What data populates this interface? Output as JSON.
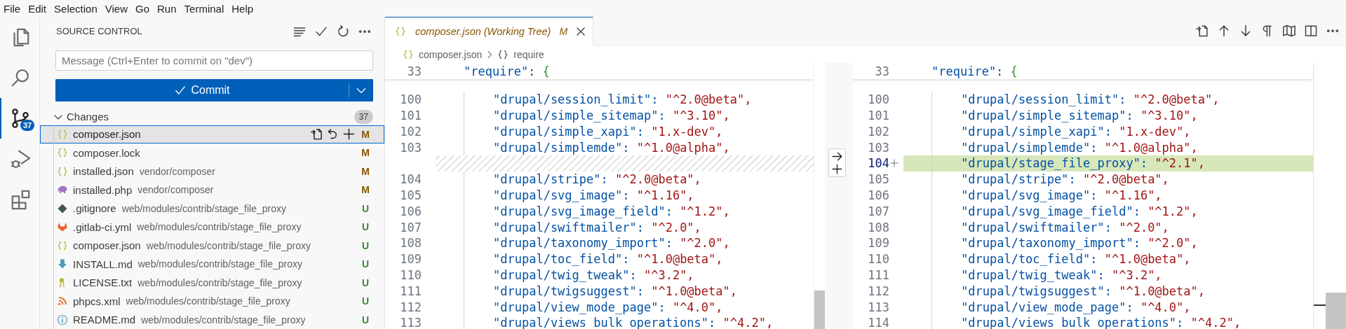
{
  "menu": [
    "File",
    "Edit",
    "Selection",
    "View",
    "Go",
    "Run",
    "Terminal",
    "Help"
  ],
  "activity_bar": [
    {
      "kind": "explorer",
      "selected": false
    },
    {
      "kind": "search",
      "selected": false
    },
    {
      "kind": "source-control",
      "selected": true,
      "badge": "37"
    },
    {
      "kind": "run-debug",
      "selected": false
    },
    {
      "kind": "extensions",
      "selected": false
    }
  ],
  "sidebar": {
    "title": "SOURCE CONTROL",
    "actions": [
      {
        "kind": "list"
      },
      {
        "kind": "check"
      },
      {
        "kind": "refresh"
      },
      {
        "kind": "more"
      }
    ],
    "message": {
      "placeholder": "Message (Ctrl+Enter to commit on \"dev\")"
    },
    "commit_button": {
      "label": "Commit"
    },
    "section": {
      "title": "Changes",
      "expanded": true,
      "count": "37",
      "files": [
        {
          "kind": "json",
          "name": "composer.json",
          "status": "M",
          "color": "#895503",
          "selected": true,
          "actions": [
            {
              "kind": "open-file"
            },
            {
              "kind": "discard"
            },
            {
              "kind": "stage"
            }
          ]
        },
        {
          "kind": "json",
          "name": "composer.lock",
          "status": "M",
          "color": "#895503",
          "selected": false
        },
        {
          "kind": "json",
          "name": "installed.json",
          "path": "vendor/composer",
          "status": "M",
          "color": "#895503",
          "selected": false
        },
        {
          "kind": "php",
          "name": "installed.php",
          "path": "vendor/composer",
          "status": "M",
          "color": "#895503",
          "selected": false
        },
        {
          "kind": "git",
          "name": ".gitignore",
          "path": "web/modules/contrib/stage_file_proxy",
          "status": "U",
          "color": "#388a34",
          "selected": false
        },
        {
          "kind": "gitlab",
          "name": ".gitlab-ci.yml",
          "path": "web/modules/contrib/stage_file_proxy",
          "status": "U",
          "color": "#388a34",
          "selected": false
        },
        {
          "kind": "json",
          "name": "composer.json",
          "path": "web/modules/contrib/stage_file_proxy",
          "status": "U",
          "color": "#388a34",
          "selected": false
        },
        {
          "kind": "download",
          "name": "INSTALL.md",
          "path": "web/modules/contrib/stage_file_proxy",
          "status": "U",
          "color": "#388a34",
          "selected": false
        },
        {
          "kind": "license",
          "name": "LICENSE.txt",
          "path": "web/modules/contrib/stage_file_proxy",
          "status": "U",
          "color": "#388a34",
          "selected": false
        },
        {
          "kind": "rss",
          "name": "phpcs.xml",
          "path": "web/modules/contrib/stage_file_proxy",
          "status": "U",
          "color": "#388a34",
          "selected": false
        },
        {
          "kind": "info",
          "name": "README.md",
          "path": "web/modules/contrib/stage_file_proxy",
          "status": "U",
          "color": "#388a34",
          "selected": false
        }
      ]
    }
  },
  "editor": {
    "tab": {
      "title": "composer.json (Working Tree)",
      "status": "M",
      "selected": true
    },
    "actions": [
      {
        "kind": "open-file"
      },
      {
        "kind": "up"
      },
      {
        "kind": "down"
      },
      {
        "kind": "pilcrow"
      },
      {
        "kind": "map"
      },
      {
        "kind": "split"
      },
      {
        "kind": "more"
      }
    ],
    "breadcrumb": [
      {
        "kind": "file",
        "label": "composer.json"
      },
      {
        "kind": "object",
        "label": "require"
      }
    ],
    "left": {
      "sticky": {
        "number": "33",
        "key": "\"require\":",
        "bracket": "{"
      },
      "lines": [
        {
          "kind": "code",
          "number": "100",
          "key": "\"drupal/session_limit\":",
          "value": "\"^2.0@beta\","
        },
        {
          "kind": "code",
          "number": "101",
          "key": "\"drupal/simple_sitemap\":",
          "value": "\"^3.10\","
        },
        {
          "kind": "code",
          "number": "102",
          "key": "\"drupal/simple_xapi\":",
          "value": "\"1.x-dev\","
        },
        {
          "kind": "code",
          "number": "103",
          "key": "\"drupal/simplemde\":",
          "value": "\"^1.0@alpha\","
        },
        {
          "kind": "gap"
        },
        {
          "kind": "code",
          "number": "104",
          "key": "\"drupal/stripe\":",
          "value": "\"^2.0@beta\","
        },
        {
          "kind": "code",
          "number": "105",
          "key": "\"drupal/svg_image\":",
          "value": "\"^1.16\","
        },
        {
          "kind": "code",
          "number": "106",
          "key": "\"drupal/svg_image_field\":",
          "value": "\"^1.2\","
        },
        {
          "kind": "code",
          "number": "107",
          "key": "\"drupal/swiftmailer\":",
          "value": "\"^2.0\","
        },
        {
          "kind": "code",
          "number": "108",
          "key": "\"drupal/taxonomy_import\":",
          "value": "\"^2.0\","
        },
        {
          "kind": "code",
          "number": "109",
          "key": "\"drupal/toc_field\":",
          "value": "\"^1.0@beta\","
        },
        {
          "kind": "code",
          "number": "110",
          "key": "\"drupal/twig_tweak\":",
          "value": "\"^3.2\","
        },
        {
          "kind": "code",
          "number": "111",
          "key": "\"drupal/twigsuggest\":",
          "value": "\"^1.0@beta\","
        },
        {
          "kind": "code",
          "number": "112",
          "key": "\"drupal/view_mode_page\":",
          "value": "\"^4.0\","
        },
        {
          "kind": "code",
          "number": "113",
          "key": "\"drupal/views bulk operations\":",
          "value": "\"^4.2\","
        }
      ]
    },
    "right": {
      "sticky": {
        "number": "33",
        "key": "\"require\":",
        "bracket": "{"
      },
      "lines": [
        {
          "kind": "code",
          "number": "100",
          "key": "\"drupal/session_limit\":",
          "value": "\"^2.0@beta\",",
          "added": false
        },
        {
          "kind": "code",
          "number": "101",
          "key": "\"drupal/simple_sitemap\":",
          "value": "\"^3.10\",",
          "added": false
        },
        {
          "kind": "code",
          "number": "102",
          "key": "\"drupal/simple_xapi\":",
          "value": "\"1.x-dev\",",
          "added": false
        },
        {
          "kind": "code",
          "number": "103",
          "key": "\"drupal/simplemde\":",
          "value": "\"^1.0@alpha\",",
          "added": false
        },
        {
          "kind": "code",
          "number": "104",
          "key": "\"drupal/stage_file_proxy\":",
          "value": "\"^2.1\",",
          "added": true
        },
        {
          "kind": "code",
          "number": "105",
          "key": "\"drupal/stripe\":",
          "value": "\"^2.0@beta\",",
          "added": false
        },
        {
          "kind": "code",
          "number": "106",
          "key": "\"drupal/svg_image\":",
          "value": "\"^1.16\",",
          "added": false
        },
        {
          "kind": "code",
          "number": "107",
          "key": "\"drupal/svg_image_field\":",
          "value": "\"^1.2\",",
          "added": false
        },
        {
          "kind": "code",
          "number": "108",
          "key": "\"drupal/swiftmailer\":",
          "value": "\"^2.0\",",
          "added": false
        },
        {
          "kind": "code",
          "number": "109",
          "key": "\"drupal/taxonomy_import\":",
          "value": "\"^2.0\",",
          "added": false
        },
        {
          "kind": "code",
          "number": "110",
          "key": "\"drupal/toc_field\":",
          "value": "\"^1.0@beta\",",
          "added": false
        },
        {
          "kind": "code",
          "number": "111",
          "key": "\"drupal/twig_tweak\":",
          "value": "\"^3.2\",",
          "added": false
        },
        {
          "kind": "code",
          "number": "112",
          "key": "\"drupal/twigsuggest\":",
          "value": "\"^1.0@beta\",",
          "added": false
        },
        {
          "kind": "code",
          "number": "113",
          "key": "\"drupal/view_mode_page\":",
          "value": "\"^4.0\",",
          "added": false
        },
        {
          "kind": "code",
          "number": "114",
          "key": "\"drupal/views bulk operations\":",
          "value": "\"^4.2\",",
          "added": false
        }
      ]
    }
  }
}
